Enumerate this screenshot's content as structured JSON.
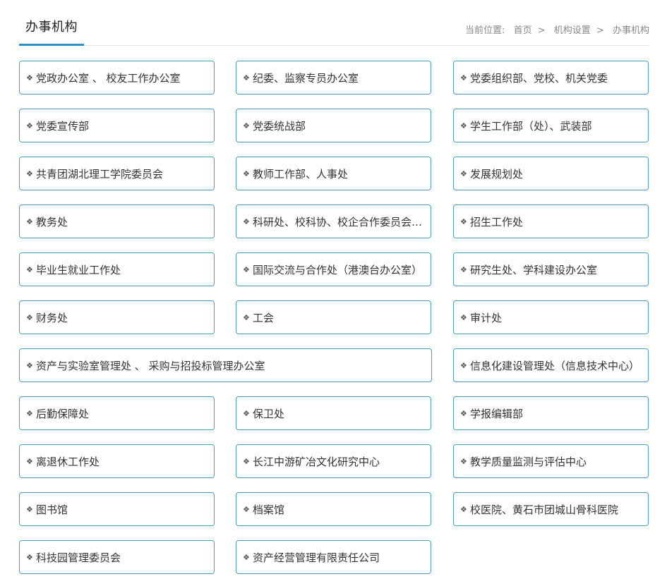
{
  "header": {
    "title": "办事机构",
    "breadcrumb": {
      "prefix": "当前位置:",
      "items": [
        "首页",
        "机构设置",
        "办事机构"
      ],
      "separator": ">"
    }
  },
  "colors": {
    "accent": "#2e8fce",
    "card_border": "#4a9cc7"
  },
  "bullet_icon": "four-diamond-icon",
  "bullet_glyph": "❖",
  "departments": [
    "党政办公室 、 校友工作办公室",
    "纪委、监察专员办公室",
    "党委组织部、党校、机关党委",
    "党委宣传部",
    "党委统战部",
    "学生工作部（处）、武装部",
    "共青团湖北理工学院委员会",
    "教师工作部、人事处",
    "发展规划处",
    "教务处",
    "科研处、校科协、校企合作委员会办公室",
    "招生工作处",
    "毕业生就业工作处",
    "国际交流与合作处（港澳台办公室）",
    "研究生处、学科建设办公室",
    "财务处",
    "工会",
    "审计处",
    "资产与实验室管理处 、 采购与招投标管理办公室",
    "信息化建设管理处（信息技术中心）",
    "后勤保障处",
    "保卫处",
    "学报编辑部",
    "离退休工作处",
    "长江中游矿冶文化研究中心",
    "教学质量监测与评估中心",
    "图书馆",
    "档案馆",
    "校医院、黄石市团城山骨科医院",
    "科技园管理委员会",
    "资产经营管理有限责任公司"
  ]
}
